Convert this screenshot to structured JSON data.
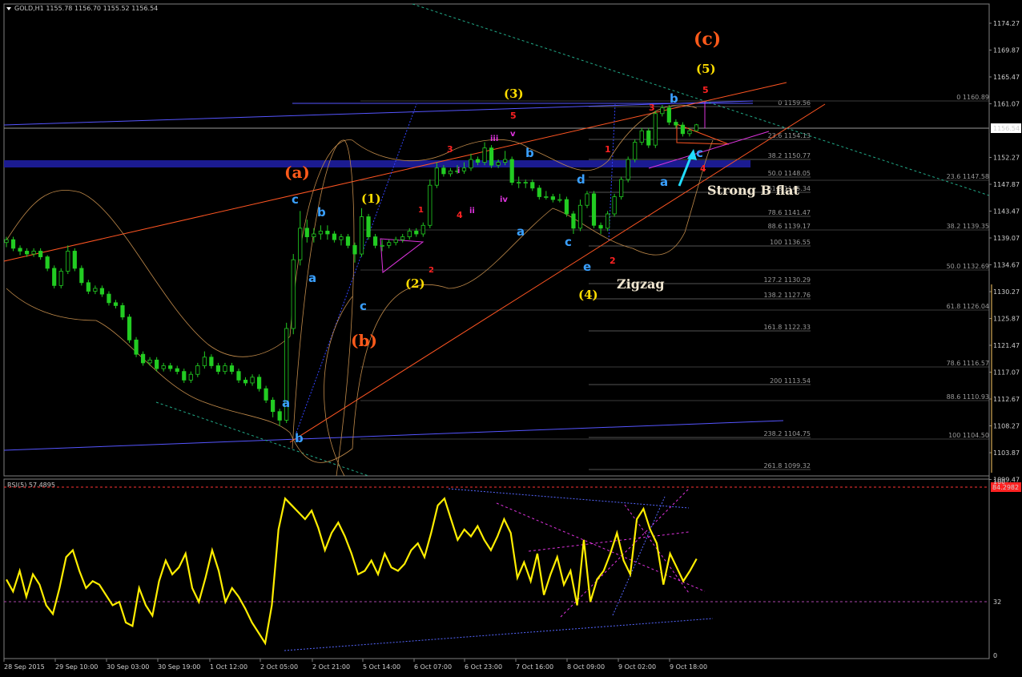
{
  "header": {
    "symbol": "GOLD,H1",
    "ohlc": "1155.78 1156.70 1155.52 1156.54"
  },
  "price_axis": {
    "labels": [
      "1174.27",
      "1169.87",
      "1165.47",
      "1161.07",
      "1156.54",
      "1152.27",
      "1147.87",
      "1143.47",
      "1139.07",
      "1134.67",
      "1130.27",
      "1125.87",
      "1121.47",
      "1117.07",
      "1112.67",
      "1108.27",
      "1103.87",
      "1099.47"
    ],
    "current_price": "1156.54"
  },
  "time_axis": {
    "labels": [
      "28 Sep 2015",
      "29 Sep 10:00",
      "30 Sep 03:00",
      "30 Sep 19:00",
      "1 Oct 12:00",
      "2 Oct 05:00",
      "2 Oct 21:00",
      "5 Oct 14:00",
      "6 Oct 07:00",
      "6 Oct 23:00",
      "7 Oct 16:00",
      "8 Oct 09:00",
      "9 Oct 02:00",
      "9 Oct 18:00"
    ]
  },
  "fib_left": [
    "0 1159.56",
    "23.6 1154.13",
    "38.2 1150.77",
    "50.0 1148.05",
    "61.8 1145.34",
    "78.6 1141.47",
    "88.6 1139.17",
    "100 1136.55",
    "127.2 1130.29",
    "138.2 1127.76",
    "161.8 1122.33",
    "200 1113.54",
    "238.2 1104.75",
    "261.8 1099.32"
  ],
  "fib_right": [
    "0 1160.89",
    "23.6 1147.58",
    "38.2 1139.35",
    "50.0 1132.69",
    "61.8 1126.04",
    "78.6 1116.57",
    "88.6 1110.93",
    "100 1104.50"
  ],
  "annotations": {
    "c_big": "(c)",
    "a_big": "(a)",
    "b_big": "(b)",
    "y5": "(5)",
    "y3": "(3)",
    "y1": "(1)",
    "y2": "(2)",
    "y4": "(4)",
    "strong_b_flat": "Strong B flat",
    "zigzag": "Zigzag",
    "r5_top": "5",
    "r3_top": "3",
    "r5_mid": "5",
    "r3_left": "3",
    "r1_left": "1",
    "r4_left": "4",
    "r2_left": "2",
    "r1_right": "1",
    "r2_right": "2",
    "r4_right": "4",
    "m_i": "i",
    "m_ii": "ii",
    "m_iii": "iii",
    "m_iv": "iv",
    "m_v": "v",
    "bl_c1": "c",
    "bl_b1": "b",
    "bl_a1": "a",
    "bl_c2": "c",
    "bl_a2": "a",
    "bl_b2": "b",
    "bl_b3": "b",
    "bl_a3": "a",
    "bl_d": "d",
    "bl_c3": "c",
    "bl_e": "e",
    "bl_a4": "a",
    "bl_b4": "b",
    "bl_c4": "c"
  },
  "rsi": {
    "label": "RSI(5) 57.4895",
    "level_high": "84.2982",
    "level_32": "32",
    "axis_100": "100",
    "axis_0": "0"
  },
  "colors": {
    "candle": "#22cc22",
    "rsi": "#ffee00",
    "fib": "#555555",
    "trend_blue": "#4444ff",
    "trend_orange": "#ff5522",
    "band": "#c08a4a",
    "zone": "#1c1c99",
    "wave_orange": "#ff5a1a",
    "wave_yellow": "#ffdd00",
    "wave_red": "#ff2222",
    "wave_magenta": "#dd33dd",
    "wave_blue": "#3aa0ff"
  },
  "chart_data": {
    "type": "candlestick",
    "symbol": "GOLD,H1",
    "ylim": [
      1099.47,
      1176.5
    ],
    "close_path": [
      [
        0,
        1136.0
      ],
      [
        2,
        1136.5
      ],
      [
        4,
        1135.0
      ],
      [
        6,
        1134.5
      ],
      [
        8,
        1134.0
      ],
      [
        10,
        1134.5
      ],
      [
        12,
        1133.5
      ],
      [
        14,
        1131.5
      ],
      [
        16,
        1128.5
      ],
      [
        18,
        1131.0
      ],
      [
        20,
        1134.5
      ],
      [
        22,
        1131.5
      ],
      [
        24,
        1129.0
      ],
      [
        26,
        1127.5
      ],
      [
        28,
        1128.0
      ],
      [
        30,
        1127.0
      ],
      [
        32,
        1125.5
      ],
      [
        34,
        1125.0
      ],
      [
        36,
        1123.0
      ],
      [
        38,
        1119.0
      ],
      [
        40,
        1116.5
      ],
      [
        42,
        1115.0
      ],
      [
        44,
        1115.5
      ],
      [
        46,
        1114.0
      ],
      [
        48,
        1114.5
      ],
      [
        50,
        1114.0
      ],
      [
        52,
        1113.5
      ],
      [
        54,
        1112.0
      ],
      [
        56,
        1113.0
      ],
      [
        58,
        1114.5
      ],
      [
        60,
        1116.0
      ],
      [
        62,
        1114.5
      ],
      [
        64,
        1113.5
      ],
      [
        66,
        1114.5
      ],
      [
        68,
        1113.5
      ],
      [
        70,
        1112.0
      ],
      [
        72,
        1111.5
      ],
      [
        74,
        1112.5
      ],
      [
        76,
        1110.5
      ],
      [
        78,
        1108.5
      ],
      [
        80,
        1106.5
      ],
      [
        81,
        1105.0
      ],
      [
        82,
        1121.0
      ],
      [
        84,
        1133.0
      ],
      [
        86,
        1138.5
      ],
      [
        88,
        1137.0
      ],
      [
        90,
        1137.5
      ],
      [
        92,
        1138.0
      ],
      [
        94,
        1137.5
      ],
      [
        96,
        1136.5
      ],
      [
        98,
        1137.0
      ],
      [
        100,
        1135.5
      ],
      [
        102,
        1134.0
      ],
      [
        104,
        1140.5
      ],
      [
        106,
        1137.0
      ],
      [
        108,
        1135.5
      ],
      [
        110,
        1135.5
      ],
      [
        112,
        1136.0
      ],
      [
        114,
        1136.5
      ],
      [
        116,
        1137.0
      ],
      [
        118,
        1138.0
      ],
      [
        120,
        1137.5
      ],
      [
        122,
        1139.0
      ],
      [
        124,
        1146.0
      ],
      [
        126,
        1149.0
      ],
      [
        128,
        1148.0
      ],
      [
        130,
        1148.5
      ],
      [
        132,
        1148.5
      ],
      [
        134,
        1149.0
      ],
      [
        136,
        1150.5
      ],
      [
        138,
        1150.0
      ],
      [
        140,
        1152.5
      ],
      [
        142,
        1149.5
      ],
      [
        144,
        1150.0
      ],
      [
        146,
        1150.5
      ],
      [
        148,
        1146.5
      ],
      [
        150,
        1146.5
      ],
      [
        152,
        1146.5
      ],
      [
        154,
        1145.5
      ],
      [
        156,
        1144.0
      ],
      [
        158,
        1144.0
      ],
      [
        160,
        1143.5
      ],
      [
        162,
        1143.5
      ],
      [
        164,
        1141.0
      ],
      [
        166,
        1138.5
      ],
      [
        168,
        1142.5
      ],
      [
        170,
        1144.5
      ],
      [
        172,
        1139.0
      ],
      [
        174,
        1138.5
      ],
      [
        176,
        1141.0
      ],
      [
        178,
        1144.0
      ],
      [
        180,
        1147.0
      ],
      [
        182,
        1150.5
      ],
      [
        184,
        1153.5
      ],
      [
        186,
        1155.5
      ],
      [
        188,
        1153.0
      ],
      [
        190,
        1158.5
      ],
      [
        192,
        1159.5
      ],
      [
        194,
        1157.0
      ],
      [
        196,
        1156.5
      ],
      [
        198,
        1155.0
      ],
      [
        200,
        1155.5
      ],
      [
        202,
        1156.54
      ]
    ],
    "candles": [
      {
        "o": 1136.0,
        "h": 1137.0,
        "l": 1135.2,
        "c": 1136.5
      },
      {
        "o": 1136.5,
        "h": 1137.0,
        "l": 1134.5,
        "c": 1135.0
      },
      {
        "o": 1135.0,
        "h": 1135.5,
        "l": 1133.8,
        "c": 1134.5
      },
      {
        "o": 1134.5,
        "h": 1135.0,
        "l": 1133.5,
        "c": 1134.0
      },
      {
        "o": 1134.0,
        "h": 1135.0,
        "l": 1133.5,
        "c": 1134.5
      },
      {
        "o": 1134.5,
        "h": 1135.0,
        "l": 1133.0,
        "c": 1133.5
      },
      {
        "o": 1133.5,
        "h": 1133.8,
        "l": 1131.0,
        "c": 1131.5
      },
      {
        "o": 1131.5,
        "h": 1132.0,
        "l": 1128.0,
        "c": 1128.5
      },
      {
        "o": 1128.5,
        "h": 1131.5,
        "l": 1128.0,
        "c": 1131.0
      },
      {
        "o": 1131.0,
        "h": 1135.5,
        "l": 1130.5,
        "c": 1134.5
      },
      {
        "o": 1134.5,
        "h": 1135.0,
        "l": 1131.0,
        "c": 1131.5
      },
      {
        "o": 1131.5,
        "h": 1132.0,
        "l": 1128.5,
        "c": 1129.0
      },
      {
        "o": 1129.0,
        "h": 1129.5,
        "l": 1127.0,
        "c": 1127.5
      },
      {
        "o": 1127.5,
        "h": 1128.5,
        "l": 1127.0,
        "c": 1128.0
      },
      {
        "o": 1128.0,
        "h": 1128.5,
        "l": 1126.5,
        "c": 1127.0
      },
      {
        "o": 1127.0,
        "h": 1127.5,
        "l": 1125.0,
        "c": 1125.5
      },
      {
        "o": 1125.5,
        "h": 1126.0,
        "l": 1124.5,
        "c": 1125.0
      },
      {
        "o": 1125.0,
        "h": 1125.5,
        "l": 1122.5,
        "c": 1123.0
      },
      {
        "o": 1123.0,
        "h": 1123.5,
        "l": 1118.5,
        "c": 1119.0
      },
      {
        "o": 1119.0,
        "h": 1119.5,
        "l": 1116.0,
        "c": 1116.5
      },
      {
        "o": 1116.5,
        "h": 1117.0,
        "l": 1114.5,
        "c": 1115.0
      },
      {
        "o": 1115.0,
        "h": 1116.0,
        "l": 1114.5,
        "c": 1115.5
      },
      {
        "o": 1115.5,
        "h": 1116.0,
        "l": 1113.5,
        "c": 1114.0
      },
      {
        "o": 1114.0,
        "h": 1115.0,
        "l": 1113.5,
        "c": 1114.5
      },
      {
        "o": 1114.5,
        "h": 1115.0,
        "l": 1113.5,
        "c": 1114.0
      },
      {
        "o": 1114.0,
        "h": 1114.5,
        "l": 1113.0,
        "c": 1113.5
      },
      {
        "o": 1113.5,
        "h": 1114.0,
        "l": 1111.5,
        "c": 1112.0
      },
      {
        "o": 1112.0,
        "h": 1113.5,
        "l": 1111.5,
        "c": 1113.0
      },
      {
        "o": 1113.0,
        "h": 1115.0,
        "l": 1112.5,
        "c": 1114.5
      },
      {
        "o": 1114.5,
        "h": 1117.0,
        "l": 1114.0,
        "c": 1116.0
      },
      {
        "o": 1116.0,
        "h": 1116.5,
        "l": 1114.0,
        "c": 1114.5
      },
      {
        "o": 1114.5,
        "h": 1115.0,
        "l": 1113.0,
        "c": 1113.5
      },
      {
        "o": 1113.5,
        "h": 1115.0,
        "l": 1113.0,
        "c": 1114.5
      },
      {
        "o": 1114.5,
        "h": 1115.0,
        "l": 1113.0,
        "c": 1113.5
      },
      {
        "o": 1113.5,
        "h": 1114.0,
        "l": 1111.5,
        "c": 1112.0
      },
      {
        "o": 1112.0,
        "h": 1112.5,
        "l": 1111.0,
        "c": 1111.5
      },
      {
        "o": 1111.5,
        "h": 1113.0,
        "l": 1111.0,
        "c": 1112.5
      },
      {
        "o": 1112.5,
        "h": 1113.0,
        "l": 1110.0,
        "c": 1110.5
      },
      {
        "o": 1110.5,
        "h": 1111.0,
        "l": 1108.0,
        "c": 1108.5
      },
      {
        "o": 1108.5,
        "h": 1109.0,
        "l": 1105.5,
        "c": 1106.5
      },
      {
        "o": 1106.5,
        "h": 1107.0,
        "l": 1104.0,
        "c": 1105.0
      },
      {
        "o": 1105.0,
        "h": 1122.0,
        "l": 1104.5,
        "c": 1121.0
      },
      {
        "o": 1121.0,
        "h": 1134.0,
        "l": 1120.0,
        "c": 1133.0
      },
      {
        "o": 1133.0,
        "h": 1141.5,
        "l": 1132.0,
        "c": 1138.5
      },
      {
        "o": 1138.5,
        "h": 1140.0,
        "l": 1136.0,
        "c": 1137.0
      },
      {
        "o": 1137.0,
        "h": 1138.5,
        "l": 1136.0,
        "c": 1137.5
      },
      {
        "o": 1137.5,
        "h": 1139.0,
        "l": 1136.5,
        "c": 1138.0
      },
      {
        "o": 1138.0,
        "h": 1139.0,
        "l": 1136.5,
        "c": 1137.5
      },
      {
        "o": 1137.5,
        "h": 1138.0,
        "l": 1136.0,
        "c": 1136.5
      },
      {
        "o": 1136.5,
        "h": 1137.5,
        "l": 1135.5,
        "c": 1137.0
      },
      {
        "o": 1137.0,
        "h": 1137.5,
        "l": 1135.0,
        "c": 1135.5
      },
      {
        "o": 1135.5,
        "h": 1136.0,
        "l": 1132.5,
        "c": 1134.0
      },
      {
        "o": 1134.0,
        "h": 1142.0,
        "l": 1133.5,
        "c": 1140.5
      },
      {
        "o": 1140.5,
        "h": 1141.0,
        "l": 1136.5,
        "c": 1137.0
      },
      {
        "o": 1137.0,
        "h": 1137.5,
        "l": 1135.0,
        "c": 1135.5
      },
      {
        "o": 1135.5,
        "h": 1136.5,
        "l": 1134.5,
        "c": 1135.5
      },
      {
        "o": 1135.5,
        "h": 1136.5,
        "l": 1135.0,
        "c": 1136.0
      },
      {
        "o": 1136.0,
        "h": 1137.0,
        "l": 1135.5,
        "c": 1136.5
      },
      {
        "o": 1136.5,
        "h": 1137.5,
        "l": 1136.0,
        "c": 1137.0
      },
      {
        "o": 1137.0,
        "h": 1138.5,
        "l": 1136.5,
        "c": 1138.0
      },
      {
        "o": 1138.0,
        "h": 1138.5,
        "l": 1137.0,
        "c": 1137.5
      },
      {
        "o": 1137.5,
        "h": 1139.5,
        "l": 1137.0,
        "c": 1139.0
      },
      {
        "o": 1139.0,
        "h": 1147.0,
        "l": 1138.5,
        "c": 1146.0
      },
      {
        "o": 1146.0,
        "h": 1150.0,
        "l": 1145.5,
        "c": 1149.0
      },
      {
        "o": 1149.0,
        "h": 1149.5,
        "l": 1147.5,
        "c": 1148.0
      },
      {
        "o": 1148.0,
        "h": 1149.0,
        "l": 1147.5,
        "c": 1148.5
      },
      {
        "o": 1148.5,
        "h": 1149.5,
        "l": 1148.0,
        "c": 1148.5
      },
      {
        "o": 1148.5,
        "h": 1150.0,
        "l": 1148.0,
        "c": 1149.0
      },
      {
        "o": 1149.0,
        "h": 1151.5,
        "l": 1148.5,
        "c": 1150.5
      },
      {
        "o": 1150.5,
        "h": 1151.0,
        "l": 1149.5,
        "c": 1150.0
      },
      {
        "o": 1150.0,
        "h": 1153.5,
        "l": 1149.5,
        "c": 1152.5
      },
      {
        "o": 1152.5,
        "h": 1153.0,
        "l": 1149.0,
        "c": 1149.5
      },
      {
        "o": 1149.5,
        "h": 1150.5,
        "l": 1149.0,
        "c": 1150.0
      },
      {
        "o": 1150.0,
        "h": 1152.0,
        "l": 1149.5,
        "c": 1150.5
      },
      {
        "o": 1150.5,
        "h": 1151.0,
        "l": 1146.0,
        "c": 1146.5
      },
      {
        "o": 1146.5,
        "h": 1147.5,
        "l": 1145.5,
        "c": 1146.5
      },
      {
        "o": 1146.5,
        "h": 1147.0,
        "l": 1145.5,
        "c": 1146.5
      },
      {
        "o": 1146.5,
        "h": 1147.0,
        "l": 1145.0,
        "c": 1145.5
      },
      {
        "o": 1145.5,
        "h": 1146.0,
        "l": 1143.5,
        "c": 1144.0
      },
      {
        "o": 1144.0,
        "h": 1145.0,
        "l": 1143.5,
        "c": 1144.0
      },
      {
        "o": 1144.0,
        "h": 1144.5,
        "l": 1143.0,
        "c": 1143.5
      },
      {
        "o": 1143.5,
        "h": 1144.5,
        "l": 1143.0,
        "c": 1143.5
      },
      {
        "o": 1143.5,
        "h": 1144.0,
        "l": 1140.5,
        "c": 1141.0
      },
      {
        "o": 1141.0,
        "h": 1141.5,
        "l": 1137.5,
        "c": 1138.5
      },
      {
        "o": 1138.5,
        "h": 1143.5,
        "l": 1138.0,
        "c": 1142.5
      },
      {
        "o": 1142.5,
        "h": 1145.0,
        "l": 1142.0,
        "c": 1144.5
      },
      {
        "o": 1144.5,
        "h": 1145.0,
        "l": 1138.5,
        "c": 1139.0
      },
      {
        "o": 1139.0,
        "h": 1139.5,
        "l": 1137.5,
        "c": 1138.5
      },
      {
        "o": 1138.5,
        "h": 1141.5,
        "l": 1138.0,
        "c": 1141.0
      },
      {
        "o": 1141.0,
        "h": 1144.5,
        "l": 1140.5,
        "c": 1144.0
      },
      {
        "o": 1144.0,
        "h": 1147.5,
        "l": 1143.5,
        "c": 1147.0
      },
      {
        "o": 1147.0,
        "h": 1151.0,
        "l": 1146.5,
        "c": 1150.5
      },
      {
        "o": 1150.5,
        "h": 1154.0,
        "l": 1150.0,
        "c": 1153.5
      },
      {
        "o": 1153.5,
        "h": 1156.0,
        "l": 1153.0,
        "c": 1155.5
      },
      {
        "o": 1155.5,
        "h": 1156.0,
        "l": 1152.5,
        "c": 1153.0
      },
      {
        "o": 1153.0,
        "h": 1159.0,
        "l": 1152.5,
        "c": 1158.5
      },
      {
        "o": 1158.5,
        "h": 1160.0,
        "l": 1158.0,
        "c": 1159.5
      },
      {
        "o": 1159.5,
        "h": 1160.0,
        "l": 1156.5,
        "c": 1157.0
      },
      {
        "o": 1157.0,
        "h": 1157.5,
        "l": 1156.0,
        "c": 1156.5
      },
      {
        "o": 1156.5,
        "h": 1157.0,
        "l": 1154.5,
        "c": 1155.0
      },
      {
        "o": 1155.0,
        "h": 1156.0,
        "l": 1154.5,
        "c": 1155.5
      },
      {
        "o": 1155.5,
        "h": 1156.7,
        "l": 1155.5,
        "c": 1156.54
      }
    ],
    "rsi_values": [
      45,
      38,
      50,
      35,
      48,
      42,
      30,
      25,
      40,
      58,
      62,
      50,
      40,
      44,
      42,
      36,
      30,
      32,
      20,
      18,
      40,
      30,
      24,
      44,
      56,
      48,
      52,
      60,
      40,
      32,
      46,
      62,
      50,
      32,
      40,
      35,
      28,
      20,
      14,
      8,
      30,
      74,
      92,
      88,
      84,
      80,
      85,
      75,
      62,
      72,
      78,
      70,
      60,
      48,
      50,
      56,
      48,
      60,
      52,
      50,
      54,
      62,
      66,
      58,
      72,
      88,
      92,
      80,
      68,
      74,
      70,
      76,
      68,
      62,
      70,
      80,
      72,
      46,
      55,
      44,
      60,
      36,
      48,
      58,
      42,
      50,
      30,
      68,
      32,
      45,
      50,
      60,
      72,
      56,
      48,
      80,
      86,
      74,
      66,
      42,
      60,
      52,
      44,
      50,
      57
    ]
  }
}
